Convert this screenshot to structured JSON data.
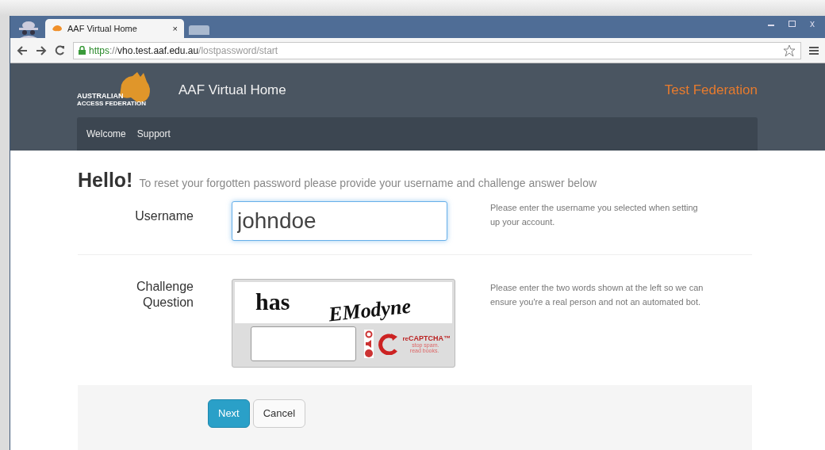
{
  "browser": {
    "tabs": [
      {
        "title": "AAF Virtual Home",
        "close": "×",
        "selected": true
      }
    ],
    "url": {
      "scheme": "https",
      "separator": "://",
      "host": "vho.test.aaf.edu.au",
      "path": "/lostpassword/start"
    },
    "close_label": "x"
  },
  "header": {
    "logo": {
      "line1": "AUSTRALIAN",
      "line2": "ACCESS FEDERATION"
    },
    "title": "AAF Virtual Home",
    "federation": "Test Federation"
  },
  "nav": [
    {
      "label": "Welcome"
    },
    {
      "label": "Support"
    }
  ],
  "heading": {
    "title": "Hello!",
    "subtitle": "To reset your forgotten password please provide your username and challenge answer below"
  },
  "fields": [
    {
      "kind": "text",
      "label": "Username",
      "value": "johndoe",
      "focused": true,
      "help": "Please enter the username you selected when setting up your account."
    },
    {
      "kind": "captcha",
      "label": "Challenge Question",
      "words": [
        "has",
        "EModyne"
      ],
      "brand_prefix": "re",
      "brand": "CAPTCHA™",
      "tagline": "stop spam. read books.",
      "help": "Please enter the two words shown at the left so we can ensure you're a real person and not an automated bot."
    }
  ],
  "buttons": [
    {
      "label": "Next",
      "kind": "primary"
    },
    {
      "label": "Cancel",
      "kind": "default"
    }
  ]
}
